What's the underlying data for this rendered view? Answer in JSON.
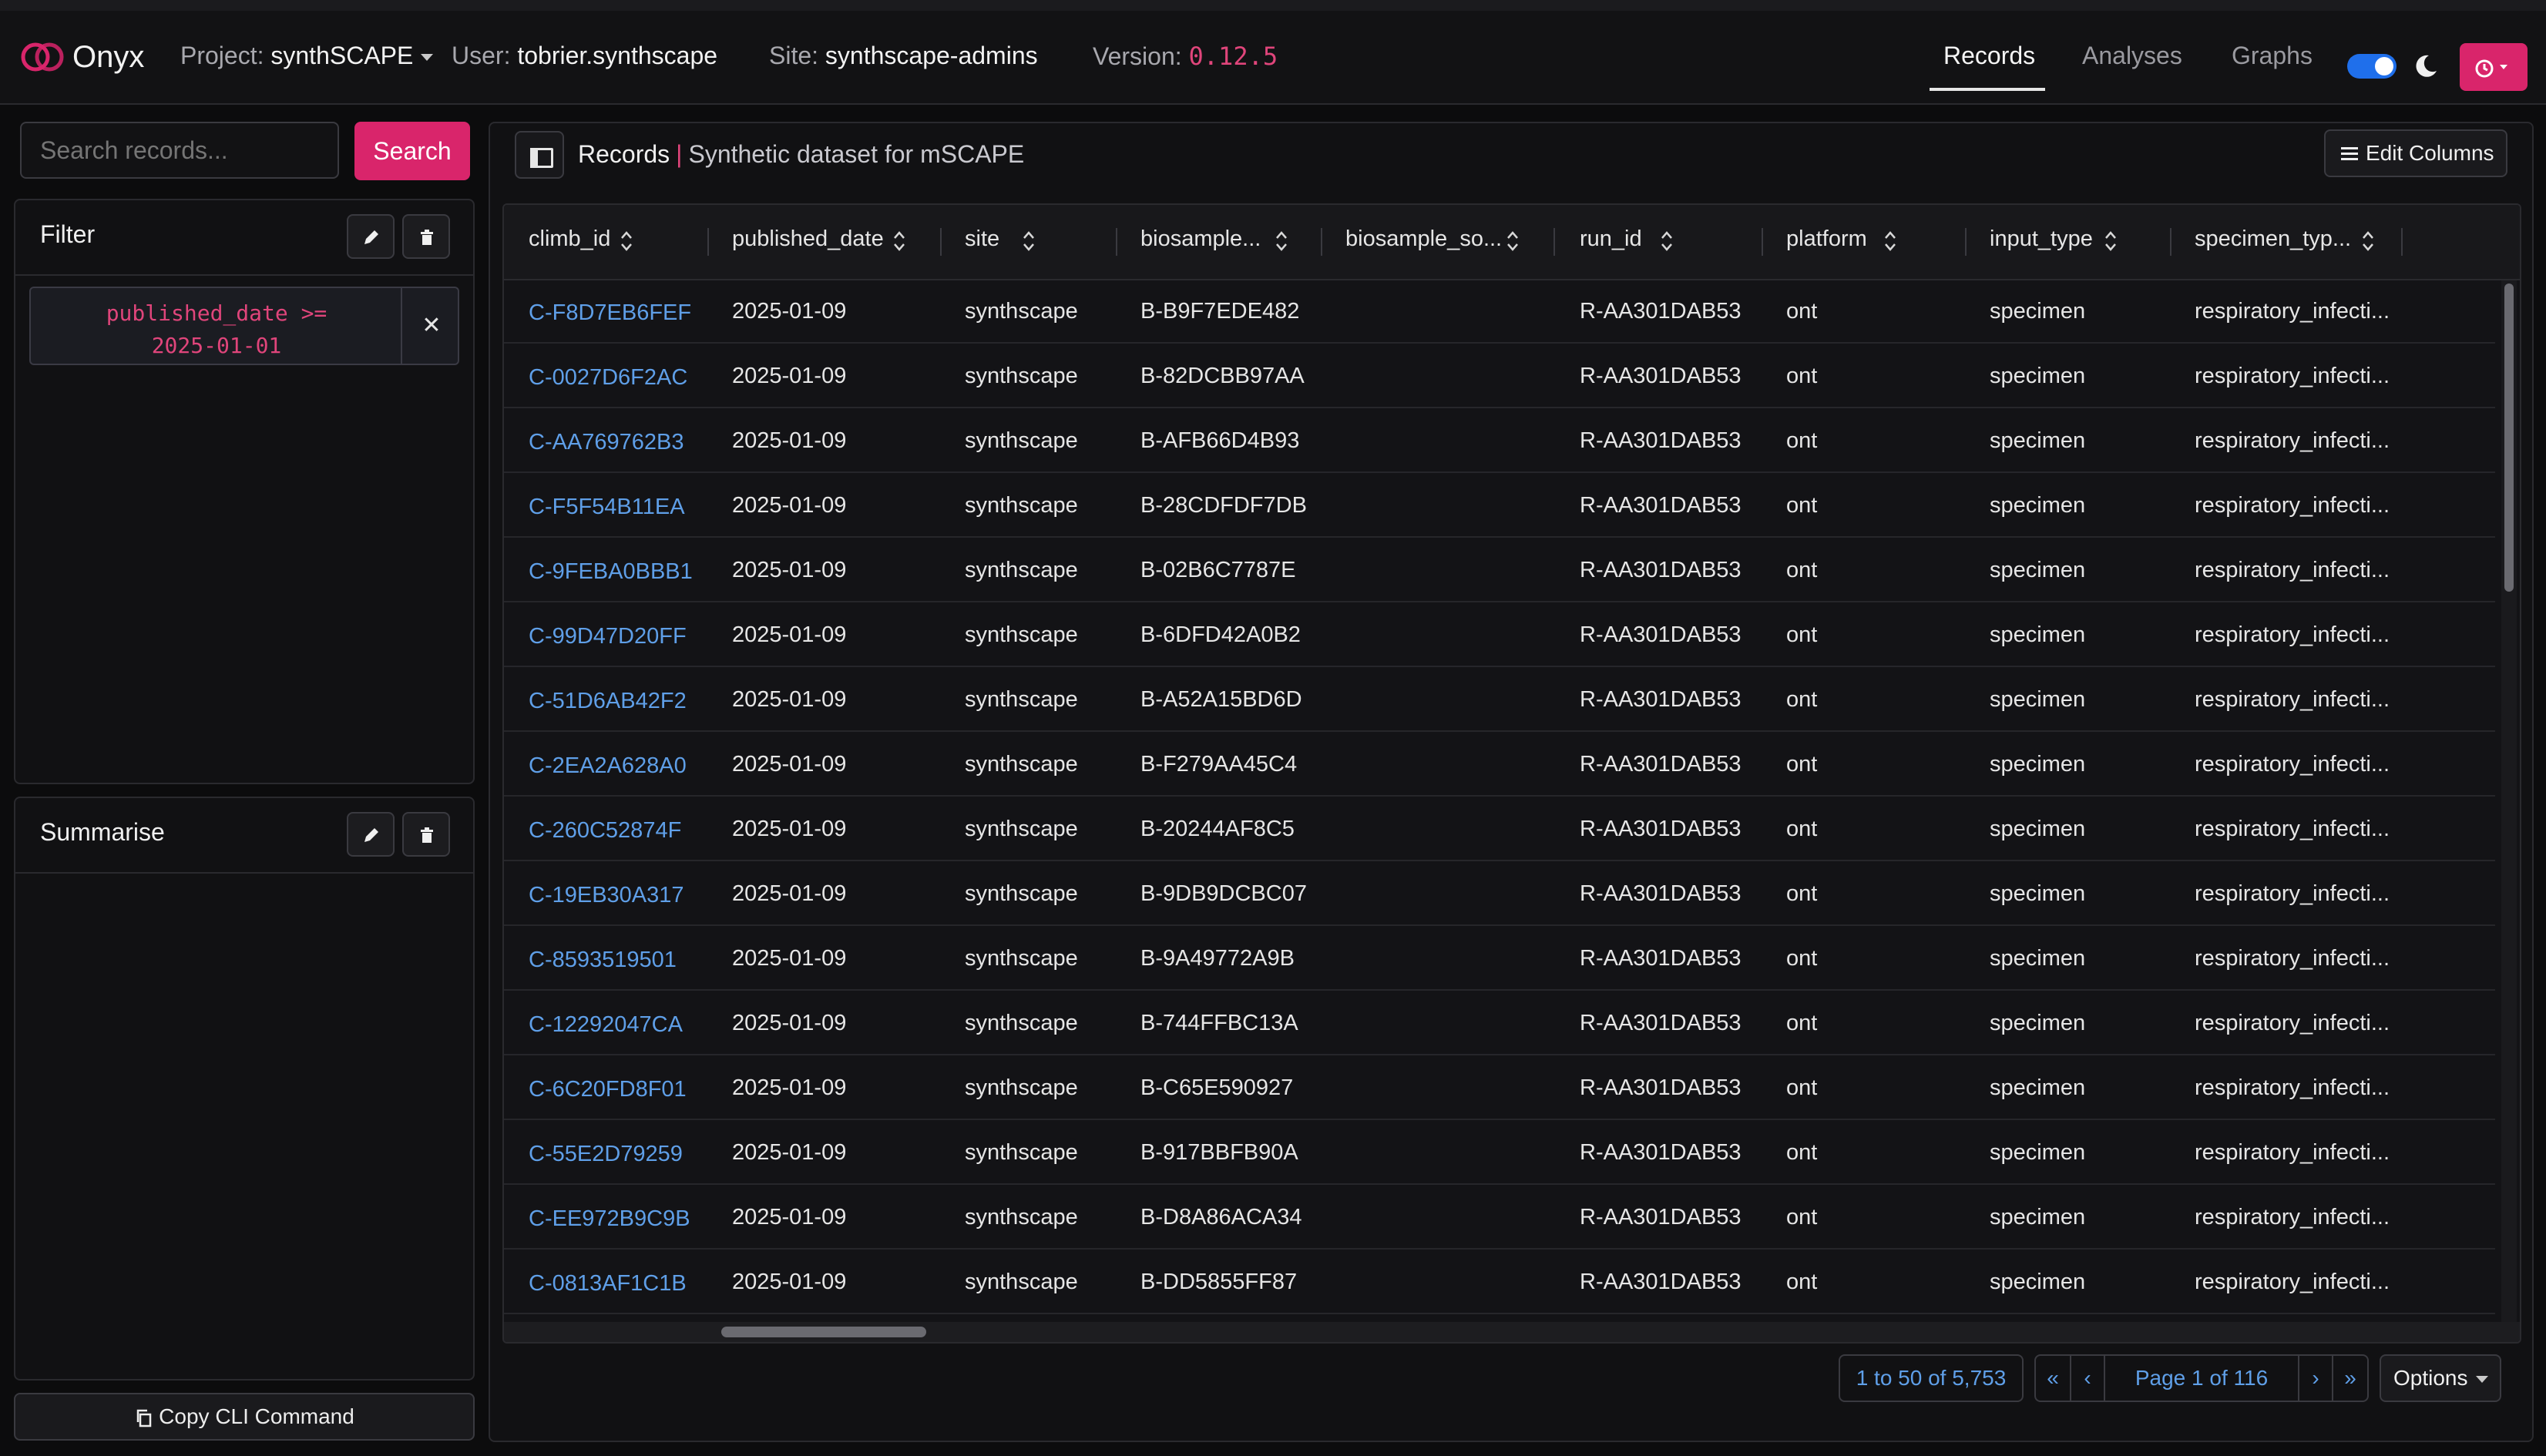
{
  "brand": "Onyx",
  "nav": {
    "project_label": "Project:",
    "project_value": "synthSCAPE",
    "user_label": "User:",
    "user_value": "tobrier.synthscape",
    "site_label": "Site:",
    "site_value": "synthscape-admins",
    "version_label": "Version:",
    "version_value": "0.12.5",
    "links": [
      "Records",
      "Analyses",
      "Graphs"
    ],
    "active_link": "Records",
    "dark_mode_enabled": true,
    "accent_color": "#d9256b",
    "link_color": "#5f9fe8"
  },
  "sidebar": {
    "search_placeholder": "Search records...",
    "search_button": "Search",
    "filter_title": "Filter",
    "filter_chip": "published_date >=\n2025-01-01",
    "summarise_title": "Summarise",
    "cli_button": "Copy CLI Command"
  },
  "main": {
    "title": "Records",
    "subtitle": "Synthetic dataset for mSCAPE",
    "edit_columns": "Edit Columns"
  },
  "table": {
    "columns": [
      "climb_id",
      "published_date",
      "site",
      "biosample...",
      "biosample_so...",
      "run_id",
      "platform",
      "input_type",
      "specimen_typ..."
    ],
    "rows": [
      [
        "C-F8D7EB6FEF",
        "2025-01-09",
        "synthscape",
        "B-B9F7EDE482",
        "",
        "R-AA301DAB53",
        "ont",
        "specimen",
        "respiratory_infecti..."
      ],
      [
        "C-0027D6F2AC",
        "2025-01-09",
        "synthscape",
        "B-82DCBB97AA",
        "",
        "R-AA301DAB53",
        "ont",
        "specimen",
        "respiratory_infecti..."
      ],
      [
        "C-AA769762B3",
        "2025-01-09",
        "synthscape",
        "B-AFB66D4B93",
        "",
        "R-AA301DAB53",
        "ont",
        "specimen",
        "respiratory_infecti..."
      ],
      [
        "C-F5F54B11EA",
        "2025-01-09",
        "synthscape",
        "B-28CDFDF7DB",
        "",
        "R-AA301DAB53",
        "ont",
        "specimen",
        "respiratory_infecti..."
      ],
      [
        "C-9FEBA0BBB1",
        "2025-01-09",
        "synthscape",
        "B-02B6C7787E",
        "",
        "R-AA301DAB53",
        "ont",
        "specimen",
        "respiratory_infecti..."
      ],
      [
        "C-99D47D20FF",
        "2025-01-09",
        "synthscape",
        "B-6DFD42A0B2",
        "",
        "R-AA301DAB53",
        "ont",
        "specimen",
        "respiratory_infecti..."
      ],
      [
        "C-51D6AB42F2",
        "2025-01-09",
        "synthscape",
        "B-A52A15BD6D",
        "",
        "R-AA301DAB53",
        "ont",
        "specimen",
        "respiratory_infecti..."
      ],
      [
        "C-2EA2A628A0",
        "2025-01-09",
        "synthscape",
        "B-F279AA45C4",
        "",
        "R-AA301DAB53",
        "ont",
        "specimen",
        "respiratory_infecti..."
      ],
      [
        "C-260C52874F",
        "2025-01-09",
        "synthscape",
        "B-20244AF8C5",
        "",
        "R-AA301DAB53",
        "ont",
        "specimen",
        "respiratory_infecti..."
      ],
      [
        "C-19EB30A317",
        "2025-01-09",
        "synthscape",
        "B-9DB9DCBC07",
        "",
        "R-AA301DAB53",
        "ont",
        "specimen",
        "respiratory_infecti..."
      ],
      [
        "C-8593519501",
        "2025-01-09",
        "synthscape",
        "B-9A49772A9B",
        "",
        "R-AA301DAB53",
        "ont",
        "specimen",
        "respiratory_infecti..."
      ],
      [
        "C-12292047CA",
        "2025-01-09",
        "synthscape",
        "B-744FFBC13A",
        "",
        "R-AA301DAB53",
        "ont",
        "specimen",
        "respiratory_infecti..."
      ],
      [
        "C-6C20FD8F01",
        "2025-01-09",
        "synthscape",
        "B-C65E590927",
        "",
        "R-AA301DAB53",
        "ont",
        "specimen",
        "respiratory_infecti..."
      ],
      [
        "C-55E2D79259",
        "2025-01-09",
        "synthscape",
        "B-917BBFB90A",
        "",
        "R-AA301DAB53",
        "ont",
        "specimen",
        "respiratory_infecti..."
      ],
      [
        "C-EE972B9C9B",
        "2025-01-09",
        "synthscape",
        "B-D8A86ACA34",
        "",
        "R-AA301DAB53",
        "ont",
        "specimen",
        "respiratory_infecti..."
      ],
      [
        "C-0813AF1C1B",
        "2025-01-09",
        "synthscape",
        "B-DD5855FF87",
        "",
        "R-AA301DAB53",
        "ont",
        "specimen",
        "respiratory_infecti..."
      ]
    ]
  },
  "footer": {
    "count": "1 to 50 of 5,753",
    "first": "«",
    "prev": "‹",
    "page": "Page 1 of 116",
    "next": "›",
    "last": "»",
    "options": "Options"
  }
}
